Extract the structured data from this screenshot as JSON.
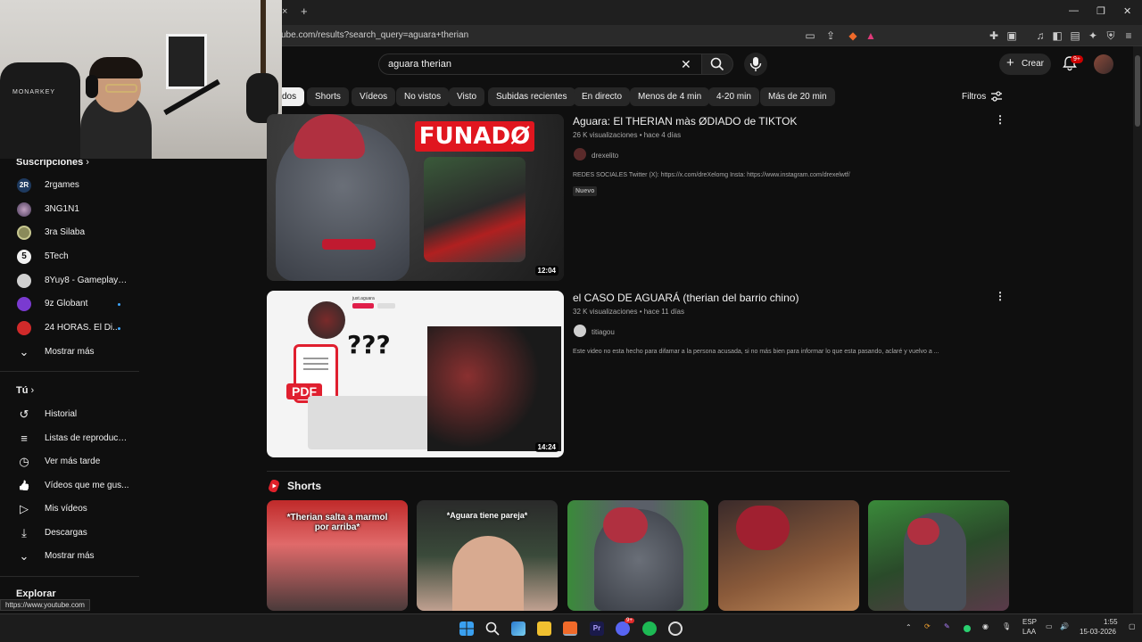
{
  "browser": {
    "url": "ube.com/results?search_query=aguara+therian",
    "new_tab": "+",
    "tab_close": "×",
    "status_url": "https://www.youtube.com"
  },
  "header": {
    "search_value": "aguara therian",
    "create_label": "Crear",
    "notification_count": "9+"
  },
  "chips": [
    "dos",
    "Shorts",
    "Vídeos",
    "No vistos",
    "Visto",
    "Subidas recientes",
    "En directo",
    "Menos de 4 min",
    "4-20 min",
    "Más de 20 min"
  ],
  "filters_label": "Filtros",
  "sidebar": {
    "subscriptions_label": "Suscripciones",
    "subscriptions": [
      {
        "label": "2rgames",
        "icon": "2R",
        "color": "#1e3a5f",
        "dot": false
      },
      {
        "label": "3NG1N1",
        "icon": "",
        "color": "#6a5a7a",
        "dot": false
      },
      {
        "label": "3ra Silaba",
        "icon": "",
        "color": "#8a8a5a",
        "dot": false
      },
      {
        "label": "5Tech",
        "icon": "5",
        "color": "#f1f1f1",
        "dot": false
      },
      {
        "label": "8Yuy8 - Gameplays ...",
        "icon": "",
        "color": "#d0d0d0",
        "dot": false
      },
      {
        "label": "9z Globant",
        "icon": "",
        "color": "#7a3ad0",
        "dot": true
      },
      {
        "label": "24 HORAS. El Di...",
        "icon": "",
        "color": "#d02a2a",
        "dot": true
      }
    ],
    "show_more": "Mostrar más",
    "you_label": "Tú",
    "you_items": [
      {
        "label": "Historial",
        "icon": "history-icon",
        "glyph": "↺"
      },
      {
        "label": "Listas de reproducc...",
        "icon": "playlists-icon",
        "glyph": "≡"
      },
      {
        "label": "Ver más tarde",
        "icon": "watch-later-icon",
        "glyph": "◷"
      },
      {
        "label": "Vídeos que me gus...",
        "icon": "like-icon",
        "glyph": "👍"
      },
      {
        "label": "Mis vídeos",
        "icon": "my-videos-icon",
        "glyph": "▷"
      },
      {
        "label": "Descargas",
        "icon": "download-icon",
        "glyph": "⤓"
      }
    ],
    "show_more_2": "Mostrar más",
    "explore_label": "Explorar"
  },
  "videos": [
    {
      "title": "Aguara: El THERIAN màs ØDIADO de TIKTOK",
      "meta": "26 K visualizaciones • hace 4 días",
      "channel": "drexelito",
      "description": "REDES SOCIALES Twitter (X): https://x.com/dreXelomg Insta: https://www.instagram.com/drexelwtf/",
      "badge": "Nuevo",
      "duration": "12:04",
      "thumb_text": "FUNADØ"
    },
    {
      "title": "el CASO DE AGUARÁ (therian del barrio chino)",
      "meta": "32 K visualizaciones • hace 11 días",
      "channel": "titiagou",
      "description": "Este video no esta hecho para difamar a la persona acusada, si no más bien para informar lo que esta pasando, aclaré y vuelvo a ...",
      "duration": "14:24",
      "thumb_text": "???",
      "pdf_text": "PDF",
      "handle": "just.aguara"
    }
  ],
  "shorts": {
    "title": "Shorts",
    "items": [
      {
        "caption": "*Therian salta a marmol por arriba*"
      },
      {
        "caption": "*Aguara tiene pareja*"
      },
      {
        "caption": ""
      },
      {
        "caption": ""
      },
      {
        "caption": ""
      }
    ]
  },
  "taskbar": {
    "lang": "ESP",
    "lang2": "LAA",
    "time": "1:55",
    "date": "15-03-2026",
    "discord_badge": "9+"
  },
  "webcam": {
    "brand": "MONARKEY"
  }
}
